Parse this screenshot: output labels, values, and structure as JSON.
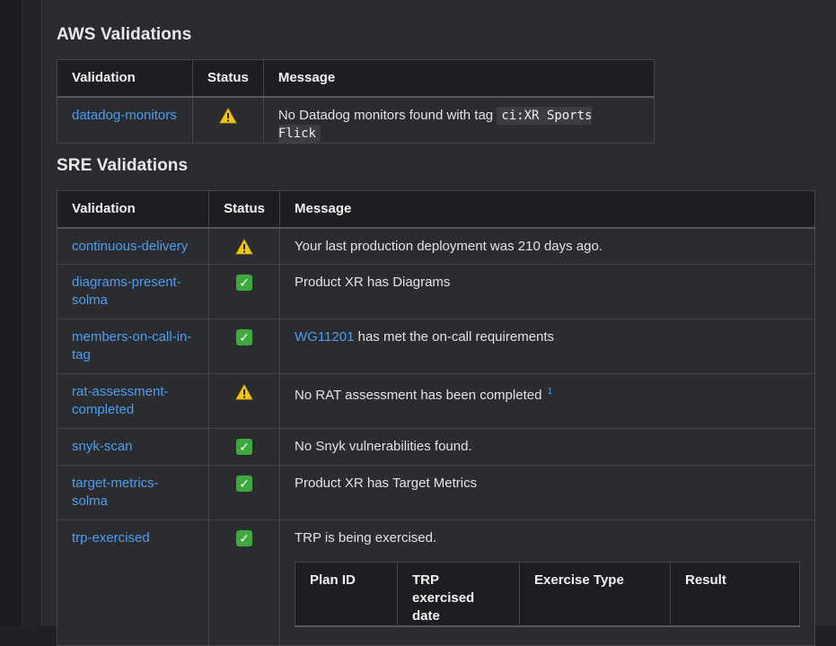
{
  "aws": {
    "heading": "AWS Validations",
    "columns": [
      "Validation",
      "Status",
      "Message"
    ],
    "rows": [
      {
        "validation": "datadog-monitors",
        "status_icon": "warning-icon",
        "message": "No Datadog monitors found with tag ",
        "code": "ci:XR Sports Flick"
      }
    ]
  },
  "sre": {
    "heading": "SRE Validations",
    "columns": [
      "Validation",
      "Status",
      "Message"
    ],
    "rows": [
      {
        "validation": "continuous-delivery",
        "status_icon": "warning-icon",
        "message": "Your last production deployment was 210 days ago."
      },
      {
        "validation": "diagrams-present-solma",
        "status_icon": "check-icon",
        "message": "Product XR has Diagrams"
      },
      {
        "validation": "members-on-call-in-tag",
        "status_icon": "check-icon",
        "message_link": "WG11201",
        "message": " has met the on-call requirements"
      },
      {
        "validation": "rat-assessment-completed",
        "status_icon": "warning-icon",
        "message": "No RAT assessment has been completed ",
        "footnote": "1"
      },
      {
        "validation": "snyk-scan",
        "status_icon": "check-icon",
        "message": "No Snyk vulnerabilities found."
      },
      {
        "validation": "target-metrics-solma",
        "status_icon": "check-icon",
        "message": "Product XR has Target Metrics"
      },
      {
        "validation": "trp-exercised",
        "status_icon": "check-icon",
        "message": "TRP is being exercised."
      }
    ],
    "trp_table": {
      "columns": [
        "Plan ID",
        "TRP exercised date",
        "Exercise Type",
        "Result"
      ]
    }
  },
  "colors": {
    "link": "#4f9df0",
    "ok": "#3fa83f",
    "warning": "#f5c518",
    "background": "#2a2b2f"
  }
}
